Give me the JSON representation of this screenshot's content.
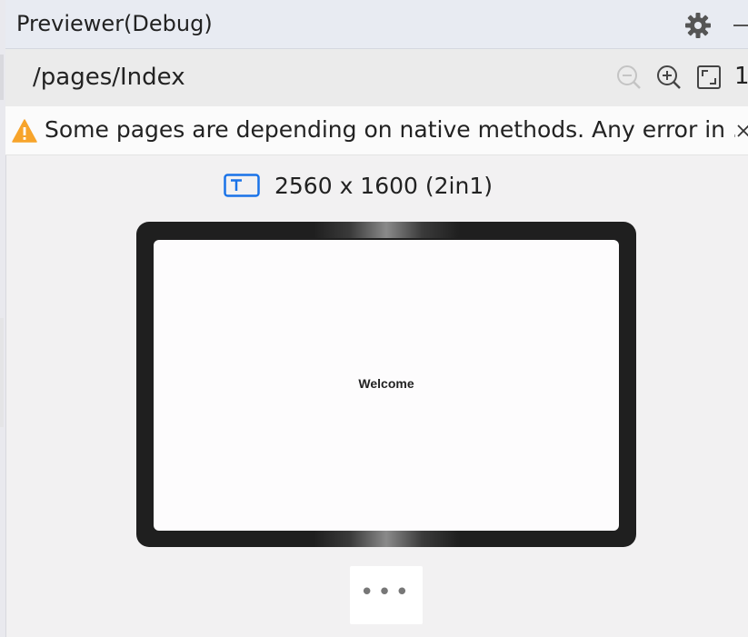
{
  "window": {
    "title": "Previewer(Debug)",
    "settings_icon": "gear-icon",
    "minimize_icon": "minimize-icon"
  },
  "toolbar": {
    "page_path": "/pages/Index",
    "zoom_out_icon": "zoom-out-icon",
    "zoom_in_icon": "zoom-in-icon",
    "fit_icon": "fit-screen-icon",
    "ratio_partial": "1"
  },
  "warning": {
    "icon": "warning-icon",
    "message": "Some pages are depending on native methods. Any error in ...",
    "close_icon": "close-icon"
  },
  "device": {
    "icon": "tablet-icon",
    "label": "2560 x 1600 (2in1)"
  },
  "preview": {
    "welcome_text": "Welcome"
  },
  "more_button": {
    "label": "•••"
  },
  "colors": {
    "accent": "#1a73e8",
    "warning": "#f7a42b",
    "frame": "#1f1f1f"
  }
}
